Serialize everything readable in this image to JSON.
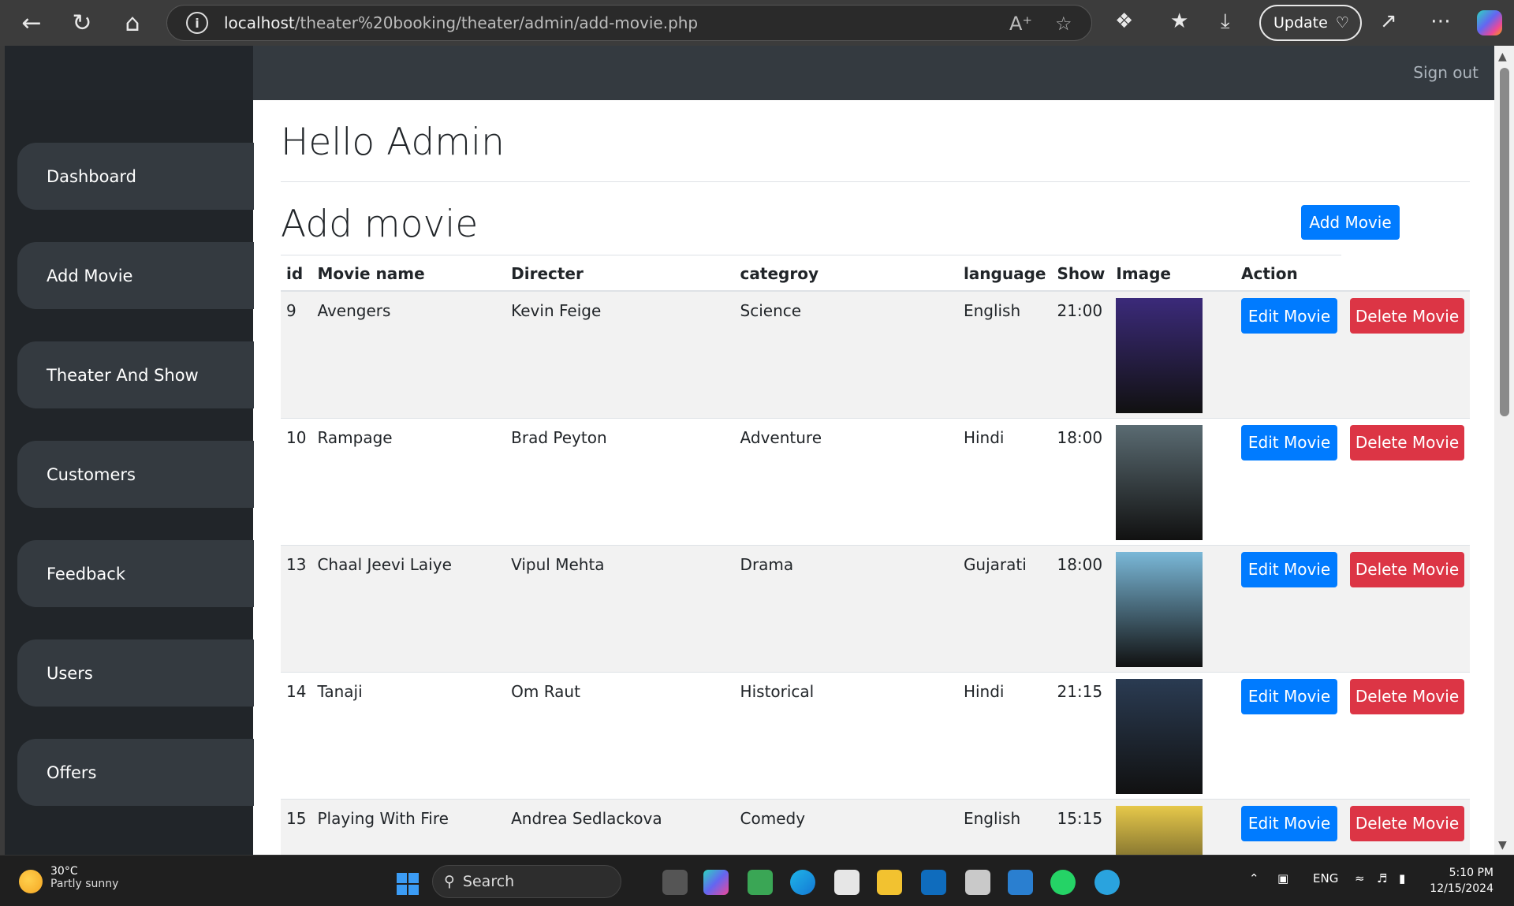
{
  "browser": {
    "url_host": "localhost",
    "url_path": "/theater%20booking/theater/admin/add-movie.php",
    "update_label": "Update"
  },
  "header": {
    "signout_label": "Sign out"
  },
  "sidebar": {
    "items": [
      {
        "label": "Dashboard"
      },
      {
        "label": "Add Movie"
      },
      {
        "label": "Theater And Show"
      },
      {
        "label": "Customers"
      },
      {
        "label": "Feedback"
      },
      {
        "label": "Users"
      },
      {
        "label": "Offers"
      }
    ]
  },
  "main": {
    "greeting": "Hello Admin",
    "section_title": "Add movie",
    "add_button_label": "Add Movie"
  },
  "table": {
    "headers": [
      "id",
      "Movie name",
      "Directer",
      "categroy",
      "language",
      "Show",
      "Image",
      "Action"
    ],
    "edit_label": "Edit Movie",
    "delete_label": "Delete Movie",
    "rows": [
      {
        "id": "9",
        "name": "Avengers",
        "director": "Kevin Feige",
        "category": "Science",
        "language": "English",
        "show": "21:00",
        "poster_color": "#3b2a7a"
      },
      {
        "id": "10",
        "name": "Rampage",
        "director": "Brad Peyton",
        "category": "Adventure",
        "language": "Hindi",
        "show": "18:00",
        "poster_color": "#5a6b72"
      },
      {
        "id": "13",
        "name": "Chaal Jeevi Laiye",
        "director": "Vipul Mehta",
        "category": "Drama",
        "language": "Gujarati",
        "show": "18:00",
        "poster_color": "#7ab8d8"
      },
      {
        "id": "14",
        "name": "Tanaji",
        "director": "Om Raut",
        "category": "Historical",
        "language": "Hindi",
        "show": "21:15",
        "poster_color": "#2a3b52"
      },
      {
        "id": "15",
        "name": "Playing With Fire",
        "director": "Andrea Sedlackova",
        "category": "Comedy",
        "language": "English",
        "show": "15:15",
        "poster_color": "#e6c84a"
      }
    ]
  },
  "taskbar": {
    "weather_temp": "30°C",
    "weather_desc": "Partly sunny",
    "search_label": "Search",
    "lang": "ENG",
    "time": "5:10 PM",
    "date": "12/15/2024"
  }
}
